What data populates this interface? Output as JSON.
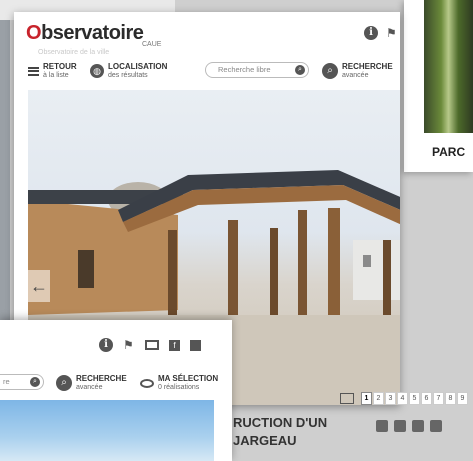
{
  "app": {
    "logo_prefix": "O",
    "logo_rest": "bservatoire",
    "logo_sub": "CAUE",
    "logo_faint": "Observatoire de la ville"
  },
  "toolbar": {
    "back": {
      "line1": "Retour",
      "line2": "à la liste"
    },
    "location": {
      "line1": "Localisation",
      "line2": "des résultats"
    },
    "search_placeholder": "Recherche libre",
    "advanced": {
      "line1": "Recherche",
      "line2": "avancée"
    }
  },
  "icons": {
    "info": "i",
    "flag": "⚑",
    "search": "⌕",
    "globe": "◍",
    "prev": "←",
    "fb": "f"
  },
  "front_window": {
    "search_placeholder": "re",
    "advanced": {
      "line1": "Recherche",
      "line2": "avancée"
    },
    "selection": {
      "line1": "Ma sélection",
      "line2": "0 réalisations"
    }
  },
  "right_window": {
    "title": "PARC"
  },
  "pager": {
    "pages": [
      "1",
      "2",
      "3",
      "4",
      "5",
      "6",
      "7",
      "8",
      "9"
    ],
    "active": "1"
  },
  "project": {
    "title_line1": "RUCTION D'UN",
    "title_line2": "JARGEAU"
  }
}
